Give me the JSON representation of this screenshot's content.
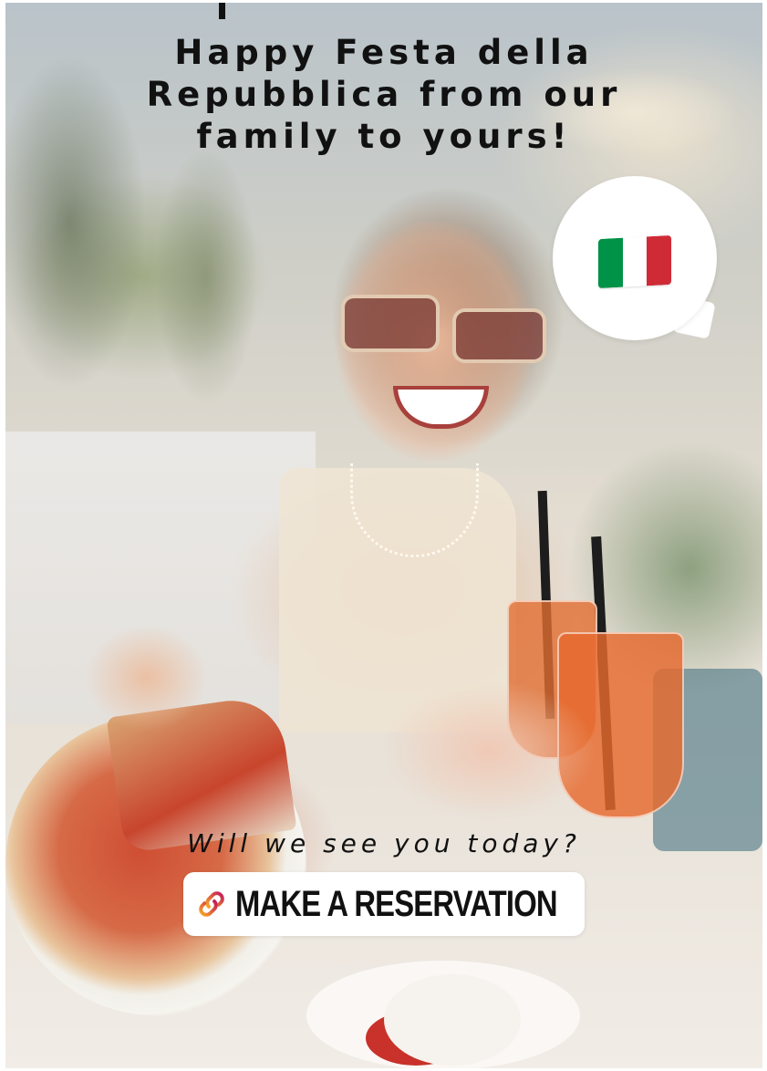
{
  "story": {
    "headline": "Happy Festa della\nRepubblica from our\nfamily to yours!",
    "question": "Will we see you today?",
    "cta_label": "MAKE A RESERVATION"
  },
  "icons": {
    "flag": "italy-flag-icon",
    "link": "link-icon"
  },
  "colors": {
    "flag_green": "#009246",
    "flag_white": "#ffffff",
    "flag_red": "#ce2b37",
    "link_gradient_start": "#f9a825",
    "link_gradient_end": "#c2185b"
  }
}
